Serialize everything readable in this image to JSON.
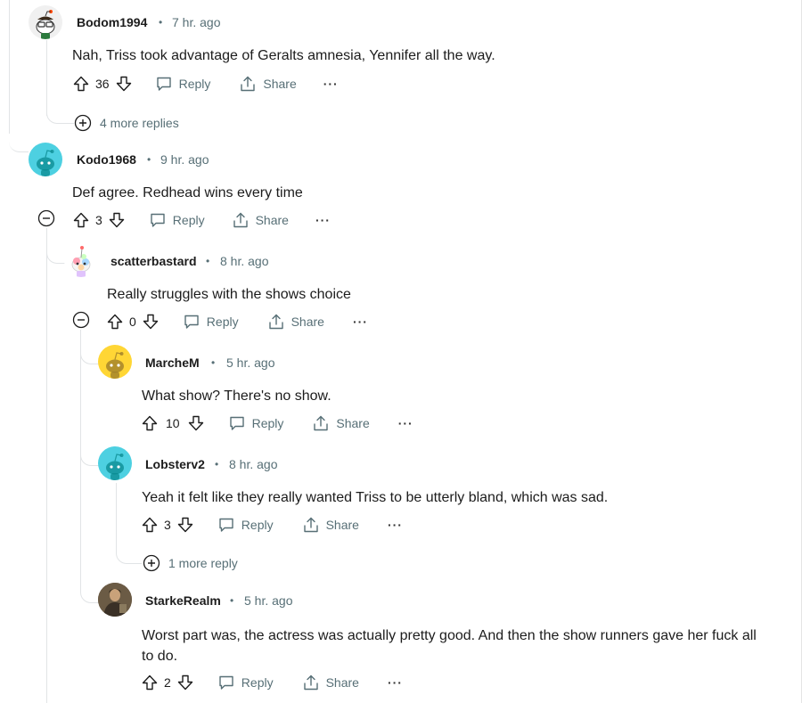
{
  "comments": [
    {
      "user": "Bodom1994",
      "time": "7 hr. ago",
      "body": "Nah, Triss took advantage of Geralts amnesia, Yennifer all the way.",
      "score": "36"
    },
    {
      "user": "Kodo1968",
      "time": "9 hr. ago",
      "body": "Def agree. Redhead wins every time",
      "score": "3"
    },
    {
      "user": "scatterbastard",
      "time": "8 hr. ago",
      "body": "Really struggles with the shows choice",
      "score": "0"
    },
    {
      "user": "MarcheM",
      "time": "5 hr. ago",
      "body": "What show? There's no show.",
      "score": "10"
    },
    {
      "user": "Lobsterv2",
      "time": "8 hr. ago",
      "body": "Yeah it felt like they really wanted Triss to be utterly bland, which was sad.",
      "score": "3"
    },
    {
      "user": "StarkeRealm",
      "time": "5 hr. ago",
      "body_line1": "Worst part was, the actress was actually pretty good. And then the show runners gave her fuck all",
      "body_line2": "to do.",
      "score": "2"
    }
  ],
  "labels": {
    "reply": "Reply",
    "share": "Share",
    "more": "···",
    "dot": "•"
  },
  "more_replies": [
    "4 more replies",
    "1 more reply"
  ],
  "icons": {
    "upvote": "upvote-icon",
    "downvote": "downvote-icon",
    "reply": "reply-icon",
    "share": "share-icon",
    "collapse": "collapse-icon",
    "expand": "expand-icon"
  },
  "colors": {
    "meta": "#576f76",
    "text": "#1c1c1c",
    "thread": "#e1e4e6",
    "teal_avatar": "#4dd0e1",
    "yellow_avatar": "#ffd635"
  }
}
